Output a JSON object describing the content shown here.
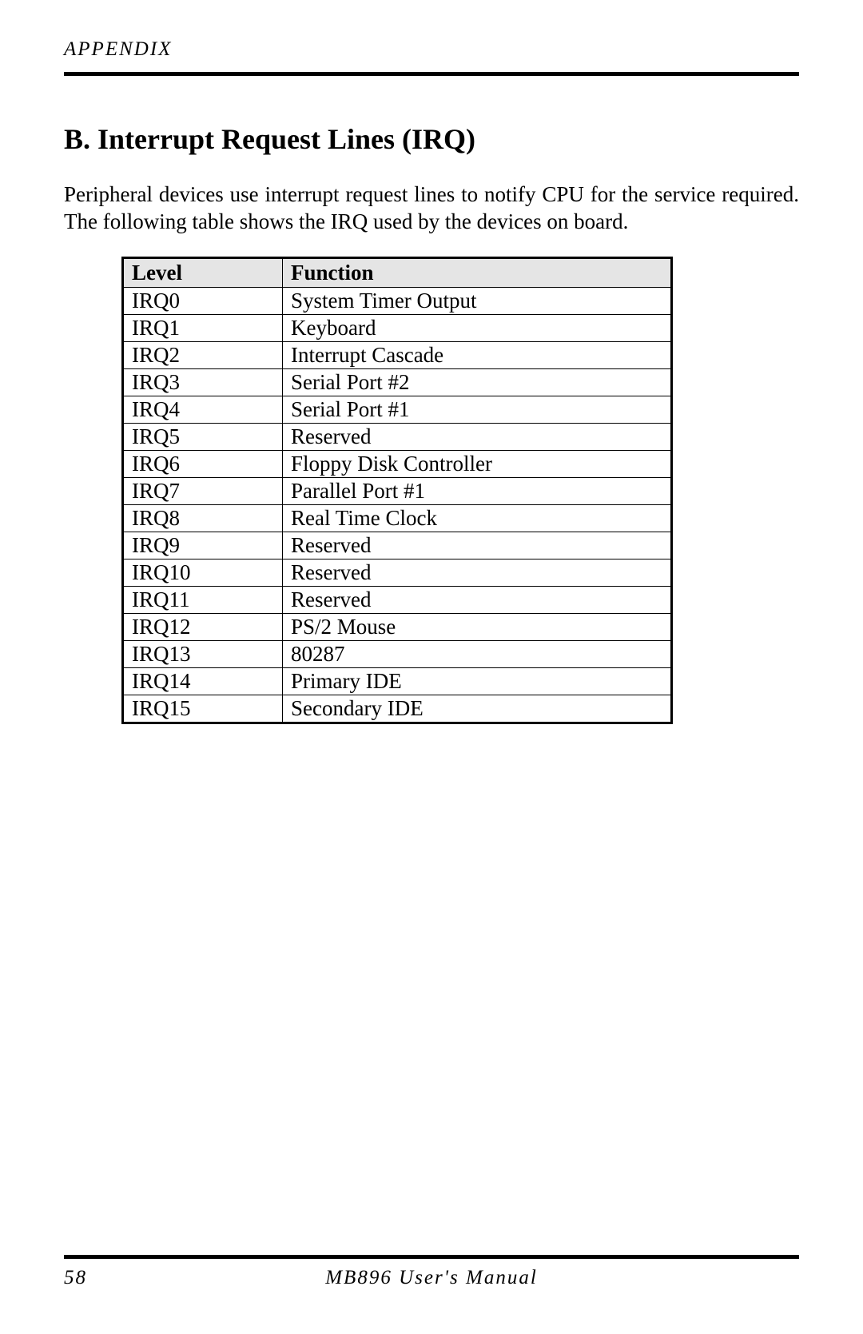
{
  "header": {
    "section_label": "APPENDIX"
  },
  "content": {
    "heading": "B. Interrupt Request Lines (IRQ)",
    "intro": "Peripheral devices use interrupt request lines to notify CPU for the service required. The following table shows the IRQ used by the devices on board."
  },
  "table": {
    "headers": {
      "level": "Level",
      "function": "Function"
    },
    "rows": [
      {
        "level": "IRQ0",
        "function": "System Timer Output"
      },
      {
        "level": "IRQ1",
        "function": "Keyboard"
      },
      {
        "level": "IRQ2",
        "function": "Interrupt Cascade"
      },
      {
        "level": "IRQ3",
        "function": "Serial Port #2"
      },
      {
        "level": "IRQ4",
        "function": "Serial Port #1"
      },
      {
        "level": "IRQ5",
        "function": "Reserved"
      },
      {
        "level": "IRQ6",
        "function": "Floppy Disk Controller"
      },
      {
        "level": "IRQ7",
        "function": "Parallel Port #1"
      },
      {
        "level": "IRQ8",
        "function": "Real Time Clock"
      },
      {
        "level": "IRQ9",
        "function": "Reserved"
      },
      {
        "level": "IRQ10",
        "function": "Reserved"
      },
      {
        "level": "IRQ11",
        "function": "Reserved"
      },
      {
        "level": "IRQ12",
        "function": "PS/2 Mouse"
      },
      {
        "level": "IRQ13",
        "function": "80287"
      },
      {
        "level": "IRQ14",
        "function": "Primary IDE"
      },
      {
        "level": "IRQ15",
        "function": "Secondary IDE"
      }
    ]
  },
  "footer": {
    "page_number": "58",
    "title": "MB896 User's Manual"
  }
}
